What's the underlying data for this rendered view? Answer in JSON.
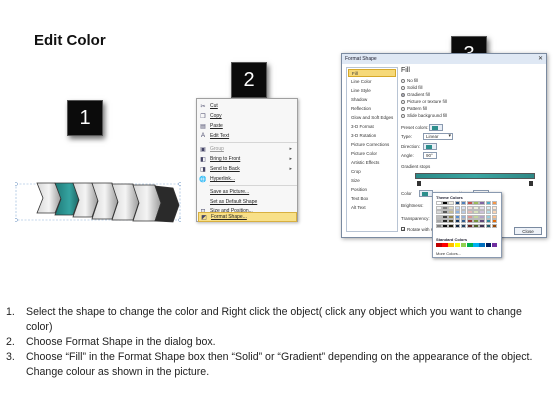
{
  "title": "Edit Color",
  "steps": [
    "1",
    "2",
    "3"
  ],
  "context_menu": {
    "items": [
      {
        "label": "Cut",
        "icon": "scissors-icon"
      },
      {
        "label": "Copy",
        "icon": "copy-icon"
      },
      {
        "label": "Paste",
        "icon": "paste-icon"
      },
      {
        "label": "Edit Text",
        "icon": "edit-text-icon"
      },
      {
        "label": "Group",
        "icon": "group-icon"
      },
      {
        "label": "Bring to Front",
        "icon": "bring-front-icon"
      },
      {
        "label": "Send to Back",
        "icon": "send-back-icon"
      },
      {
        "label": "Hyperlink...",
        "icon": "hyperlink-icon"
      },
      {
        "label": "Save as Picture...",
        "icon": "none"
      },
      {
        "label": "Set as Default Shape",
        "icon": "none"
      },
      {
        "label": "Size and Position...",
        "icon": "size-icon"
      },
      {
        "label": "Format Shape...",
        "icon": "format-shape-icon"
      }
    ]
  },
  "dialog": {
    "title": "Format Shape",
    "close_glyph": "✕",
    "nav": [
      "Fill",
      "Line Color",
      "Line Style",
      "Shadow",
      "Reflection",
      "Glow and Soft Edges",
      "3-D Format",
      "3-D Rotation",
      "Picture Corrections",
      "Picture Color",
      "Artistic Effects",
      "Crop",
      "Size",
      "Position",
      "Text Box",
      "Alt Text"
    ],
    "heading": "Fill",
    "fill_options": [
      "No fill",
      "Solid fill",
      "Gradient fill",
      "Picture or texture fill",
      "Pattern fill",
      "Slide background fill"
    ],
    "selected_fill": 2,
    "preset_label": "Preset colors:",
    "type_label": "Type:",
    "type_value": "Linear",
    "direction_label": "Direction:",
    "angle_label": "Angle:",
    "angle_value": "90°",
    "stops_label": "Gradient stops",
    "color_label": "Color",
    "position_label": "Position:",
    "position_value": "3%",
    "brightness_label": "Brightness:",
    "transparency_label": "Transparency:",
    "rotate_label": "Rotate with shape",
    "close_label": "Close"
  },
  "palette": {
    "theme_label": "Theme Colors",
    "standard_label": "Standard Colors",
    "more_label": "More Colors...",
    "accent": "#2d8e8c"
  },
  "instructions": [
    "Select the shape to change the color and Right click the object( click any object which you want to change color)",
    "Choose Format Shape in the dialog box.",
    "Choose “Fill” in the Format Shape box then “Solid” or “Gradient” depending on the appearance of the object. Change colour as shown in the picture."
  ]
}
